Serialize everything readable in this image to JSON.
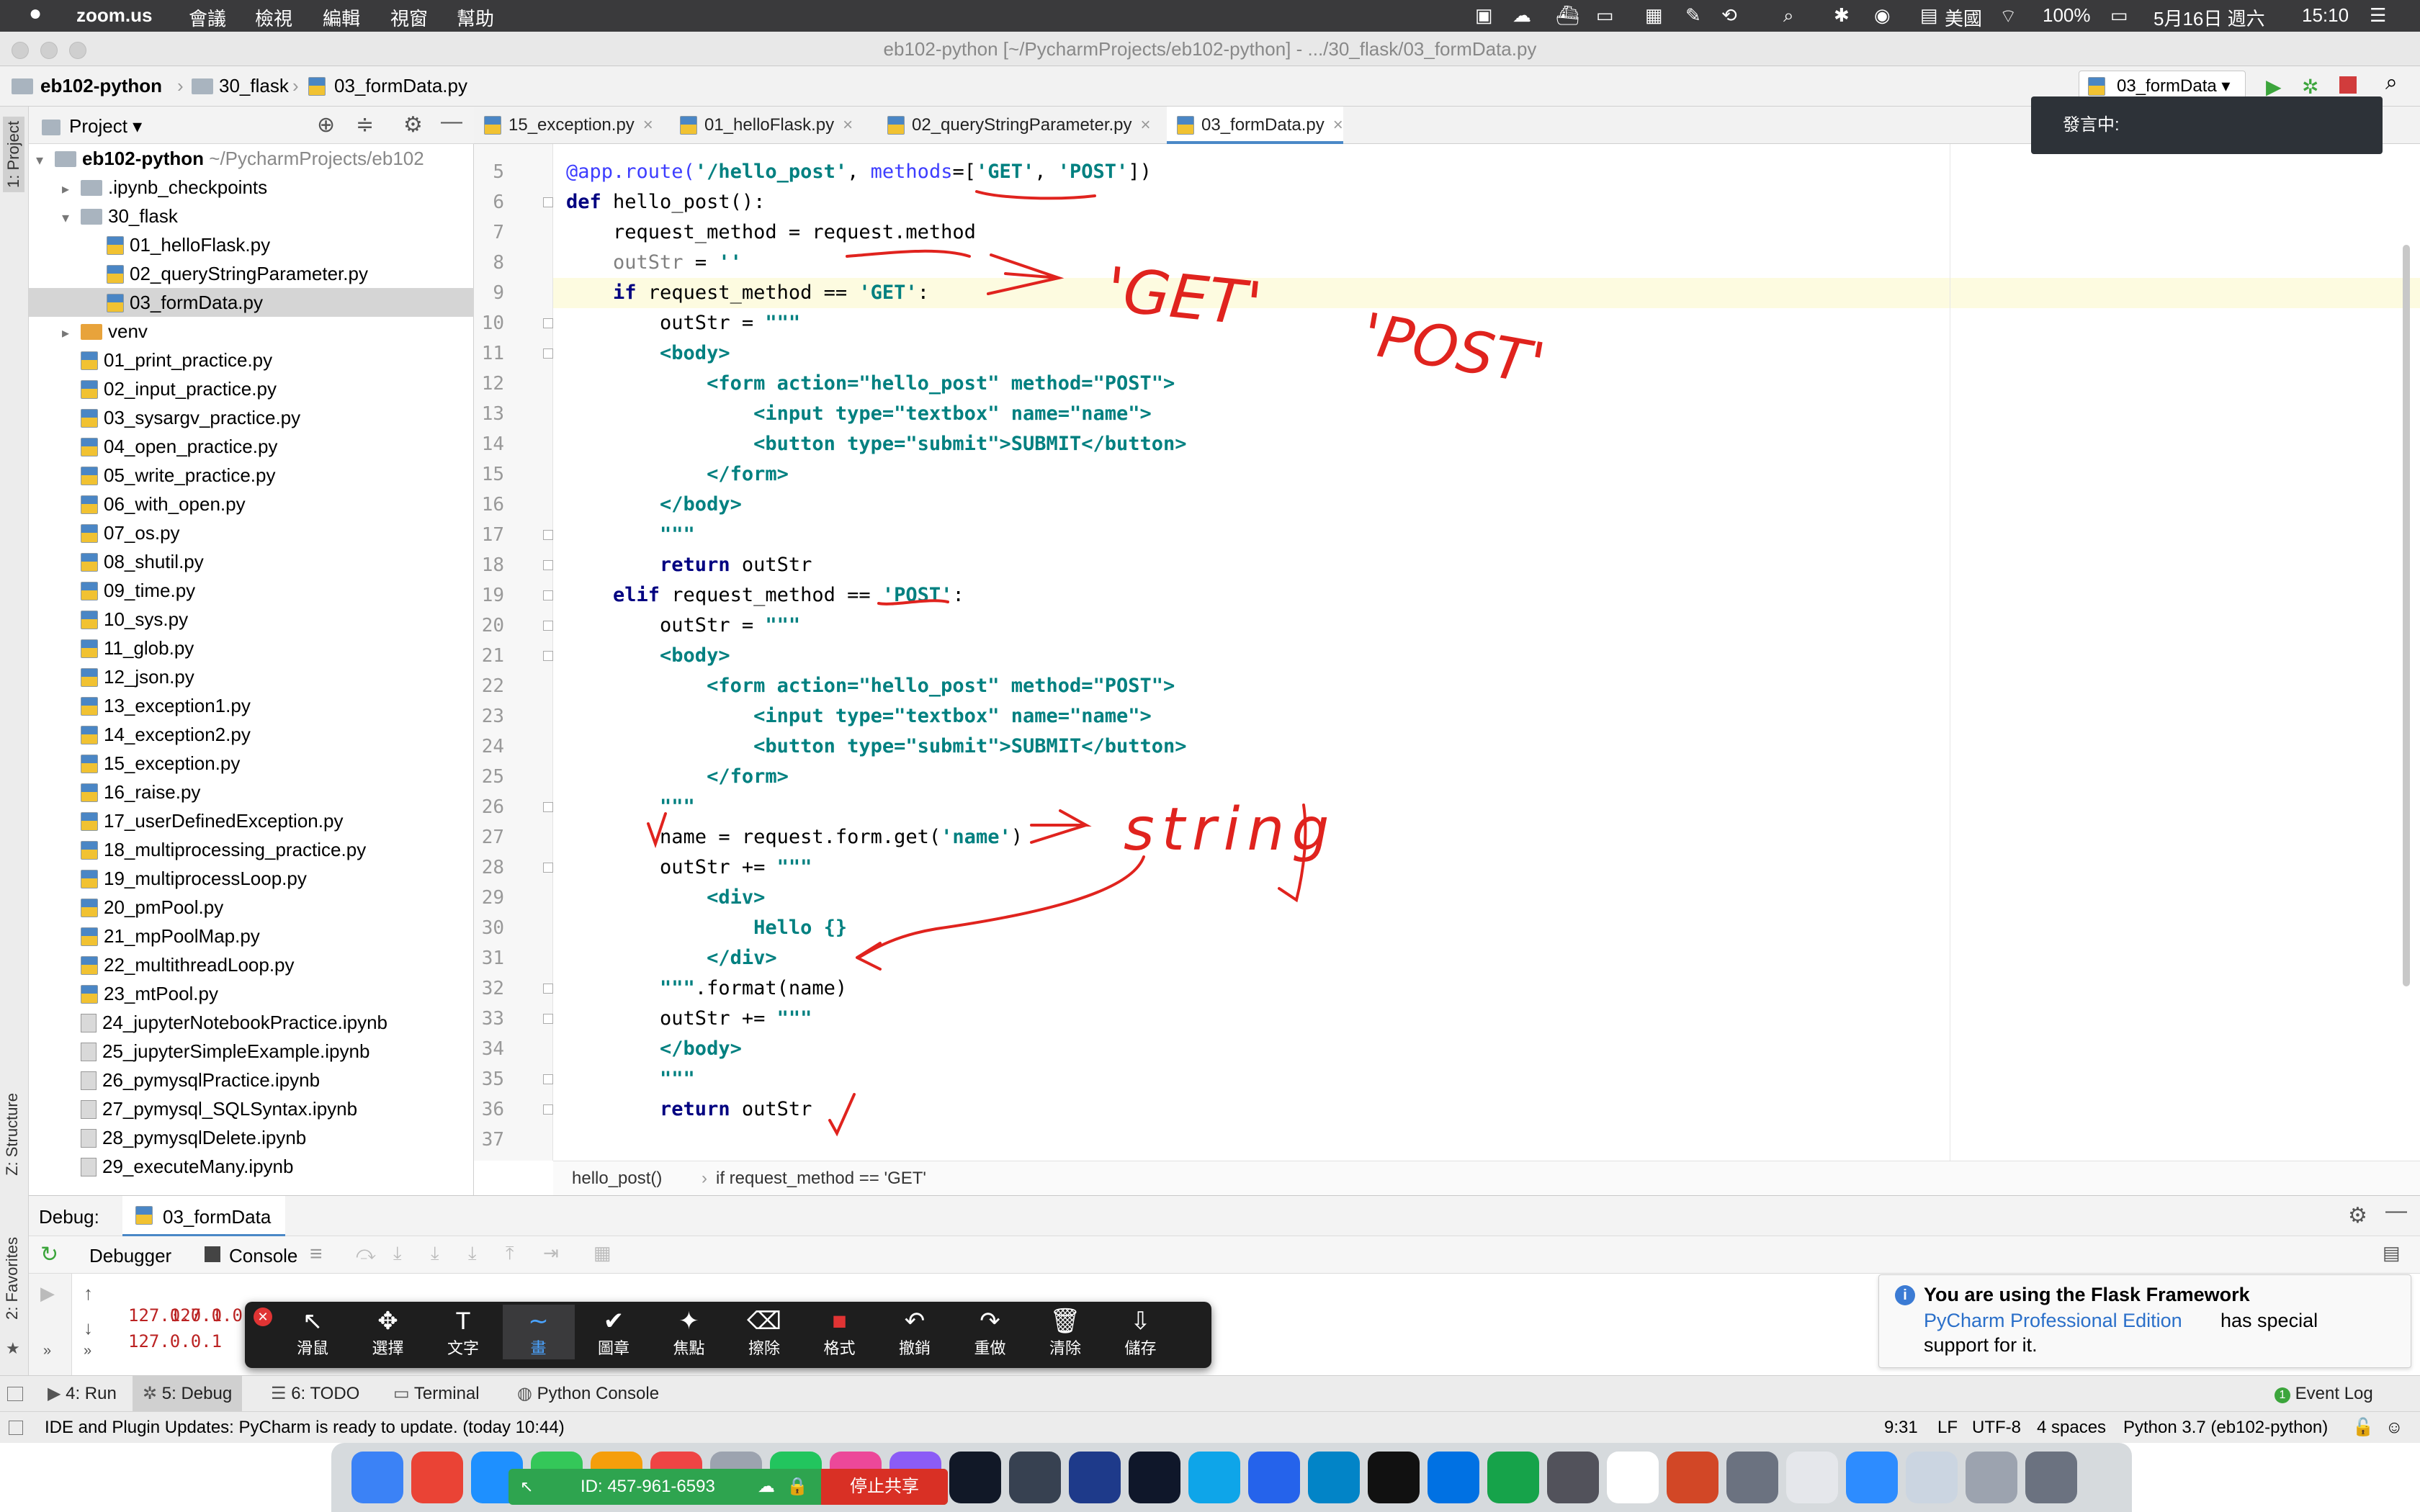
{
  "menubar": {
    "apple": "",
    "app": "zoom.us",
    "items": [
      "會議",
      "檢視",
      "編輯",
      "視窗",
      "幫助"
    ],
    "right": {
      "input_source": "美國",
      "battery": "100%",
      "date": "5月16日 週六",
      "time": "15:10"
    }
  },
  "window": {
    "title": "eb102-python [~/PycharmProjects/eb102-python] - .../30_flask/03_formData.py"
  },
  "navbar": {
    "crumbs": [
      "eb102-python",
      "30_flask",
      "03_formData.py"
    ],
    "run_config": "03_formData"
  },
  "sidebar": {
    "project_label": "1: Project",
    "structure_label": "Z: Structure",
    "favorites_label": "2: Favorites"
  },
  "project": {
    "header": "Project",
    "root": {
      "name": "eb102-python",
      "path": "~/PycharmProjects/eb102"
    },
    "items": [
      {
        "name": ".ipynb_checkpoints",
        "type": "folder",
        "indent": 1
      },
      {
        "name": "30_flask",
        "type": "folder-open",
        "indent": 1
      },
      {
        "name": "01_helloFlask.py",
        "type": "py",
        "indent": 2
      },
      {
        "name": "02_queryStringParameter.py",
        "type": "py",
        "indent": 2
      },
      {
        "name": "03_formData.py",
        "type": "py",
        "indent": 2,
        "selected": true
      },
      {
        "name": "venv",
        "type": "folder-orange",
        "indent": 1
      },
      {
        "name": "01_print_practice.py",
        "type": "py",
        "indent": 1
      },
      {
        "name": "02_input_practice.py",
        "type": "py",
        "indent": 1
      },
      {
        "name": "03_sysargv_practice.py",
        "type": "py",
        "indent": 1
      },
      {
        "name": "04_open_practice.py",
        "type": "py",
        "indent": 1
      },
      {
        "name": "05_write_practice.py",
        "type": "py",
        "indent": 1
      },
      {
        "name": "06_with_open.py",
        "type": "py",
        "indent": 1
      },
      {
        "name": "07_os.py",
        "type": "py",
        "indent": 1
      },
      {
        "name": "08_shutil.py",
        "type": "py",
        "indent": 1
      },
      {
        "name": "09_time.py",
        "type": "py",
        "indent": 1
      },
      {
        "name": "10_sys.py",
        "type": "py",
        "indent": 1
      },
      {
        "name": "11_glob.py",
        "type": "py",
        "indent": 1
      },
      {
        "name": "12_json.py",
        "type": "py",
        "indent": 1
      },
      {
        "name": "13_exception1.py",
        "type": "py",
        "indent": 1
      },
      {
        "name": "14_exception2.py",
        "type": "py",
        "indent": 1
      },
      {
        "name": "15_exception.py",
        "type": "py",
        "indent": 1
      },
      {
        "name": "16_raise.py",
        "type": "py",
        "indent": 1
      },
      {
        "name": "17_userDefinedException.py",
        "type": "py",
        "indent": 1
      },
      {
        "name": "18_multiprocessing_practice.py",
        "type": "py",
        "indent": 1
      },
      {
        "name": "19_multiprocessLoop.py",
        "type": "py",
        "indent": 1
      },
      {
        "name": "20_pmPool.py",
        "type": "py",
        "indent": 1
      },
      {
        "name": "21_mpPoolMap.py",
        "type": "py",
        "indent": 1
      },
      {
        "name": "22_multithreadLoop.py",
        "type": "py",
        "indent": 1
      },
      {
        "name": "23_mtPool.py",
        "type": "py",
        "indent": 1
      },
      {
        "name": "24_jupyterNotebookPractice.ipynb",
        "type": "nb",
        "indent": 1
      },
      {
        "name": "25_jupyterSimpleExample.ipynb",
        "type": "nb",
        "indent": 1
      },
      {
        "name": "26_pymysqlPractice.ipynb",
        "type": "nb",
        "indent": 1
      },
      {
        "name": "27_pymysql_SQLSyntax.ipynb",
        "type": "nb",
        "indent": 1
      },
      {
        "name": "28_pymysqlDelete.ipynb",
        "type": "nb",
        "indent": 1
      },
      {
        "name": "29_executeMany.ipynb",
        "type": "nb",
        "indent": 1
      }
    ]
  },
  "tabs": [
    {
      "label": "15_exception.py"
    },
    {
      "label": "01_helloFlask.py"
    },
    {
      "label": "02_queryStringParameter.py"
    },
    {
      "label": "03_formData.py",
      "active": true
    }
  ],
  "editor": {
    "first_line": 5,
    "breadcrumb": [
      "hello_post()",
      "if request_method == 'GET'"
    ],
    "lines": [
      [
        [
          "dec",
          "@app.route("
        ],
        [
          "st",
          "'/hello_post'"
        ],
        [
          "",
          ","
        ],
        [
          "dec",
          " methods"
        ],
        [
          "",
          "=["
        ],
        [
          "st",
          "'GET'"
        ],
        [
          "",
          ", "
        ],
        [
          "st",
          "'POST'"
        ],
        [
          "",
          "])"
        ]
      ],
      [
        [
          "kw",
          "def"
        ],
        [
          "",
          " hello_post():"
        ]
      ],
      [
        [
          "",
          "    request_method = request.method"
        ]
      ],
      [
        [
          "gray",
          "    outStr"
        ],
        [
          "",
          " = "
        ],
        [
          "st",
          "''"
        ]
      ],
      [
        [
          "kw",
          "    if"
        ],
        [
          "",
          " request_method == "
        ],
        [
          "st",
          "'GET'"
        ],
        [
          "",
          ":"
        ]
      ],
      [
        [
          "",
          "        outStr = "
        ],
        [
          "st",
          "\"\"\""
        ]
      ],
      [
        [
          "tg",
          "        <body>"
        ]
      ],
      [
        [
          "tg",
          "            <form action=\"hello_post\" method=\"POST\">"
        ]
      ],
      [
        [
          "tg",
          "                <input type=\"textbox\" name=\"name\">"
        ]
      ],
      [
        [
          "tg",
          "                <button type=\"submit\">SUBMIT</button>"
        ]
      ],
      [
        [
          "tg",
          "            </form>"
        ]
      ],
      [
        [
          "tg",
          "        </body>"
        ]
      ],
      [
        [
          "st",
          "        \"\"\""
        ]
      ],
      [
        [
          "kw",
          "        return"
        ],
        [
          "",
          " outStr"
        ]
      ],
      [
        [
          "kw",
          "    elif"
        ],
        [
          "",
          " request_method == "
        ],
        [
          "st",
          "'POST'"
        ],
        [
          "",
          ":"
        ]
      ],
      [
        [
          "",
          "        outStr = "
        ],
        [
          "st",
          "\"\"\""
        ]
      ],
      [
        [
          "tg",
          "        <body>"
        ]
      ],
      [
        [
          "tg",
          "            <form action=\"hello_post\" method=\"POST\">"
        ]
      ],
      [
        [
          "tg",
          "                <input type=\"textbox\" name=\"name\">"
        ]
      ],
      [
        [
          "tg",
          "                <button type=\"submit\">SUBMIT</button>"
        ]
      ],
      [
        [
          "tg",
          "            </form>"
        ]
      ],
      [
        [
          "st",
          "        \"\"\""
        ]
      ],
      [
        [
          "",
          "        name = request.form.get("
        ],
        [
          "st",
          "'name'"
        ],
        [
          "",
          ")"
        ]
      ],
      [
        [
          "",
          "        outStr += "
        ],
        [
          "st",
          "\"\"\""
        ]
      ],
      [
        [
          "tg",
          "            <div>"
        ]
      ],
      [
        [
          "tg",
          "                Hello {}"
        ]
      ],
      [
        [
          "tg",
          "            </div>"
        ]
      ],
      [
        [
          "st",
          "        \"\"\""
        ],
        [
          "",
          ".format(name)"
        ]
      ],
      [
        [
          "",
          "        outStr += "
        ],
        [
          "st",
          "\"\"\""
        ]
      ],
      [
        [
          "tg",
          "        </body>"
        ]
      ],
      [
        [
          "st",
          "        \"\"\""
        ]
      ],
      [
        [
          "kw",
          "        return"
        ],
        [
          "",
          " outStr"
        ]
      ],
      [
        [
          "",
          ""
        ]
      ]
    ]
  },
  "annotations": {
    "get": "'GET'",
    "post": "'POST'",
    "string": "string"
  },
  "speaking": {
    "label": "發言中:"
  },
  "debug": {
    "title": "Debug:",
    "config": "03_formData",
    "tabs": [
      "Debugger",
      "Console"
    ],
    "console_lines": [
      "127.0.0.1 - - [16/May/2020 15:07:21] \"POST /hello_post HTTP/1.1\" 200 -",
      "127.0.0.1",
      "127.0.0.1"
    ]
  },
  "zoom_toolbar": {
    "tools": [
      {
        "icon": "↖",
        "label": "滑鼠"
      },
      {
        "icon": "✥",
        "label": "選擇"
      },
      {
        "icon": "T",
        "label": "文字"
      },
      {
        "icon": "∼",
        "label": "畫"
      },
      {
        "icon": "✔",
        "label": "圖章"
      },
      {
        "icon": "✦",
        "label": "焦點"
      },
      {
        "icon": "⌫",
        "label": "擦除"
      },
      {
        "icon": "■",
        "label": "格式"
      },
      {
        "icon": "↶",
        "label": "撤銷"
      },
      {
        "icon": "↷",
        "label": "重做"
      },
      {
        "icon": "🗑",
        "label": "清除"
      },
      {
        "icon": "⇩",
        "label": "儲存"
      }
    ]
  },
  "flask_note": {
    "title": "You are using the Flask Framework",
    "link": "PyCharm Professional Edition",
    "rest": "has special",
    "rest2": "support for it."
  },
  "toolwindows": [
    {
      "label": "4: Run"
    },
    {
      "label": "5: Debug"
    },
    {
      "label": "6: TODO"
    },
    {
      "label": "Terminal"
    },
    {
      "label": "Python Console"
    }
  ],
  "event_log": "Event Log",
  "status": {
    "message": "IDE and Plugin Updates: PyCharm is ready to update. (today 10:44)",
    "pos": "9:31",
    "lf": "LF",
    "enc": "UTF-8",
    "indent": "4 spaces",
    "interp": "Python 3.7 (eb102-python)"
  },
  "share": {
    "id": "ID: 457-961-6593",
    "stop": "停止共享"
  }
}
